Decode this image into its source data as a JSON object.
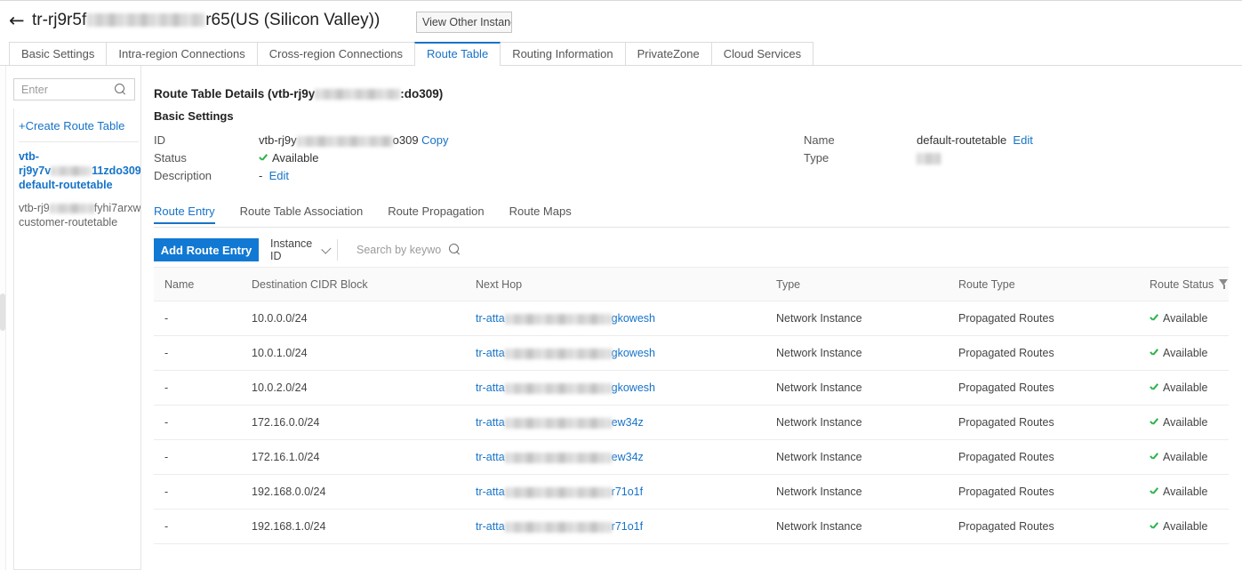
{
  "colors": {
    "accent": "#1673c8",
    "button_blue": "#1179d3",
    "status_green": "#2cb34a",
    "border": "#e4e4e4",
    "header_bg": "#fafafa"
  },
  "header": {
    "back_icon": "arrow-left-icon",
    "title_prefix": "tr-rj9r5f",
    "title_suffix": "r65(US (Silicon Valley))",
    "view_other_instance_label": "View Other Instances"
  },
  "main_tabs": [
    {
      "label": "Basic Settings",
      "active": false
    },
    {
      "label": "Intra-region Connections",
      "active": false
    },
    {
      "label": "Cross-region Connections",
      "active": false
    },
    {
      "label": "Route Table",
      "active": true
    },
    {
      "label": "Routing Information",
      "active": false
    },
    {
      "label": "PrivateZone",
      "active": false
    },
    {
      "label": "Cloud Services",
      "active": false
    }
  ],
  "sidebar": {
    "search": {
      "value": "",
      "placeholder": "Enter",
      "icon": "search-icon"
    },
    "create_label": "+Create Route Table",
    "items": [
      {
        "line1": "vtb-",
        "line2_prefix": "rj9y7v",
        "line2_suffix": "11zdo309",
        "line3": "default-routetable",
        "selected": true
      },
      {
        "line1_prefix": "vtb-rj9",
        "line1_suffix": "fyhi7arxw",
        "line2": "customer-routetable",
        "selected": false
      }
    ]
  },
  "details": {
    "heading_prefix": "Route Table Details (vtb-rj9y",
    "heading_suffix": ":do309)",
    "basic_settings_label": "Basic Settings",
    "fields": {
      "id_label": "ID",
      "id_prefix": "vtb-rj9y",
      "id_suffix": "o309",
      "id_copy_label": "Copy",
      "status_label": "Status",
      "status_value": "Available",
      "description_label": "Description",
      "description_value": "-",
      "description_edit_label": "Edit",
      "name_label": "Name",
      "name_value": "default-routetable",
      "name_edit_label": "Edit",
      "type_label": "Type",
      "type_value": ""
    }
  },
  "inner_tabs": [
    {
      "label": "Route Entry",
      "active": true
    },
    {
      "label": "Route Table Association",
      "active": false
    },
    {
      "label": "Route Propagation",
      "active": false
    },
    {
      "label": "Route Maps",
      "active": false
    }
  ],
  "toolbar": {
    "add_route_entry_label": "Add Route Entry",
    "filter_select_value": "Instance ID",
    "filter_select_icon": "chevron-down-icon",
    "search": {
      "value": "",
      "placeholder": "Search by keyword",
      "icon": "search-icon"
    }
  },
  "table": {
    "columns": [
      {
        "key": "name",
        "label": "Name"
      },
      {
        "key": "cidr",
        "label": "Destination CIDR Block"
      },
      {
        "key": "hop",
        "label": "Next Hop"
      },
      {
        "key": "type",
        "label": "Type"
      },
      {
        "key": "rtype",
        "label": "Route Type"
      },
      {
        "key": "status",
        "label": "Route Status",
        "filter_icon": "funnel-icon"
      }
    ],
    "rows": [
      {
        "name": "-",
        "cidr": "10.0.0.0/24",
        "hop_prefix": "tr-atta",
        "hop_suffix": "gkowesh",
        "type": "Network Instance",
        "rtype": "Propagated Routes",
        "status": "Available"
      },
      {
        "name": "-",
        "cidr": "10.0.1.0/24",
        "hop_prefix": "tr-atta",
        "hop_suffix": "gkowesh",
        "type": "Network Instance",
        "rtype": "Propagated Routes",
        "status": "Available"
      },
      {
        "name": "-",
        "cidr": "10.0.2.0/24",
        "hop_prefix": "tr-atta",
        "hop_suffix": "gkowesh",
        "type": "Network Instance",
        "rtype": "Propagated Routes",
        "status": "Available"
      },
      {
        "name": "-",
        "cidr": "172.16.0.0/24",
        "hop_prefix": "tr-atta",
        "hop_suffix": "ew34z",
        "type": "Network Instance",
        "rtype": "Propagated Routes",
        "status": "Available"
      },
      {
        "name": "-",
        "cidr": "172.16.1.0/24",
        "hop_prefix": "tr-atta",
        "hop_suffix": "ew34z",
        "type": "Network Instance",
        "rtype": "Propagated Routes",
        "status": "Available"
      },
      {
        "name": "-",
        "cidr": "192.168.0.0/24",
        "hop_prefix": "tr-atta",
        "hop_suffix": "r71o1f",
        "type": "Network Instance",
        "rtype": "Propagated Routes",
        "status": "Available"
      },
      {
        "name": "-",
        "cidr": "192.168.1.0/24",
        "hop_prefix": "tr-atta",
        "hop_suffix": "r71o1f",
        "type": "Network Instance",
        "rtype": "Propagated Routes",
        "status": "Available"
      }
    ]
  }
}
